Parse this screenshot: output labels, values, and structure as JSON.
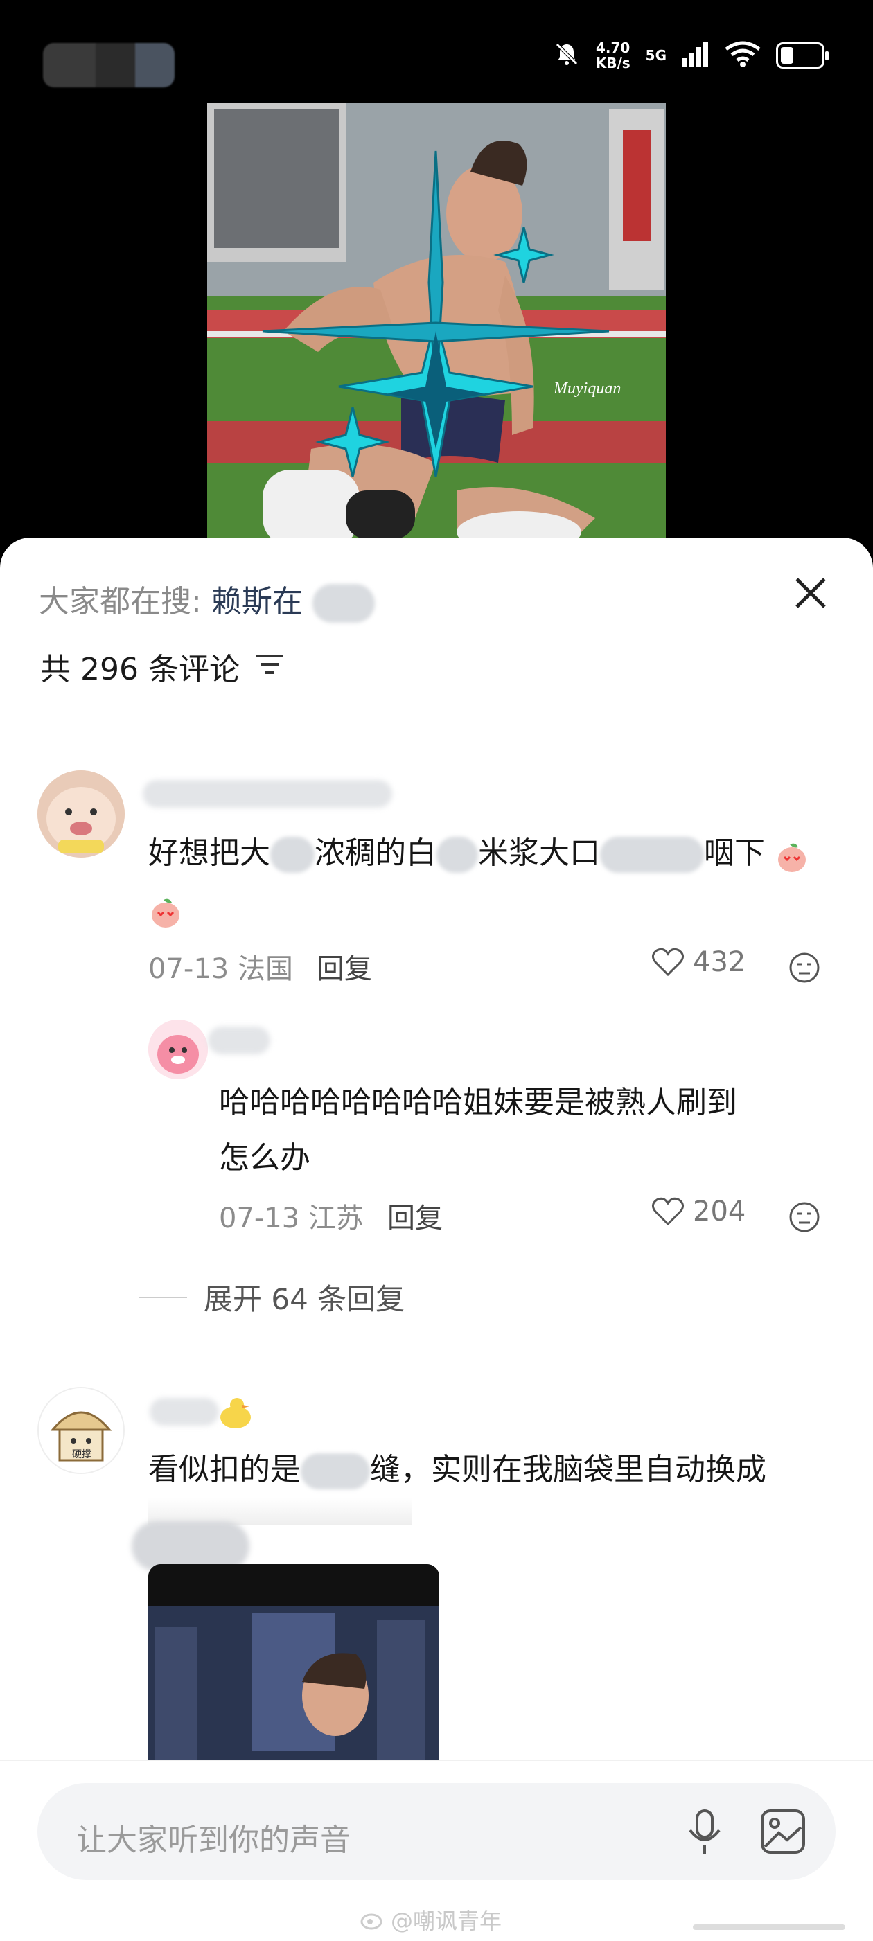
{
  "status": {
    "speed_value": "4.70",
    "speed_unit": "KB/s",
    "network": "5G",
    "icons": [
      "mute-bell-icon",
      "signal-icon",
      "wifi-icon",
      "battery-icon"
    ]
  },
  "post": {
    "watermark_text": "Muyiquan"
  },
  "sheet": {
    "search_prefix": "大家都在搜:",
    "search_term": "赖斯在",
    "comment_count_text": "共 296 条评论"
  },
  "comments": [
    {
      "text_a": "好想把大",
      "text_b": "浓稠的白",
      "text_c": "米浆大口",
      "text_d": "咽下",
      "date": "07-13",
      "location": "法国",
      "reply_label": "回复",
      "likes": "432"
    },
    {
      "text": "哈哈哈哈哈哈哈哈姐妹要是被熟人刷到",
      "text2": "怎么办",
      "date": "07-13",
      "location": "江苏",
      "reply_label": "回复",
      "likes": "204"
    },
    {
      "text_a": "看似扣的是",
      "text_b": "缝，实则在我脑袋里自动换成",
      "avatar_caption": "硬撑"
    }
  ],
  "expand_text": "展开 64 条回复",
  "composer": {
    "placeholder": "让大家听到你的声音"
  },
  "footer_watermark": "@嘲讽青年"
}
